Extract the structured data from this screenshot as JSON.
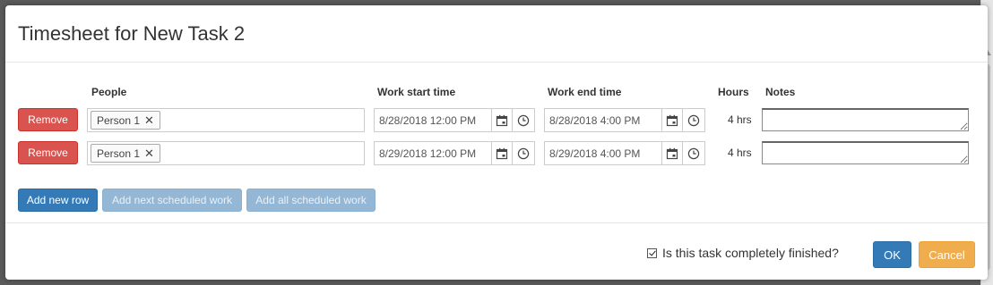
{
  "dialog": {
    "title": "Timesheet for New Task 2"
  },
  "columns": {
    "people": "People",
    "start": "Work start time",
    "end": "Work end time",
    "hours": "Hours",
    "notes": "Notes"
  },
  "rows": [
    {
      "remove_label": "Remove",
      "person": "Person 1",
      "start": "8/28/2018 12:00 PM",
      "end": "8/28/2018 4:00 PM",
      "hours": "4 hrs",
      "notes": ""
    },
    {
      "remove_label": "Remove",
      "person": "Person 1",
      "start": "8/29/2018 12:00 PM",
      "end": "8/29/2018 4:00 PM",
      "hours": "4 hrs",
      "notes": ""
    }
  ],
  "actions": {
    "add_new_row": "Add new row",
    "add_next_scheduled": "Add next scheduled work",
    "add_all_scheduled": "Add all scheduled work"
  },
  "footer": {
    "finished_label": "Is this task completely finished?",
    "finished_checked": true,
    "ok_label": "OK",
    "cancel_label": "Cancel"
  },
  "icons": {
    "remove_tag": "close-icon",
    "date_picker": "calendar-icon",
    "time_picker": "clock-icon",
    "checkbox": "checkbox-checked-icon"
  },
  "colors": {
    "danger": "#d9534f",
    "primary": "#337ab7",
    "primary_disabled": "#94b7d6",
    "warning": "#f0ad4e"
  }
}
